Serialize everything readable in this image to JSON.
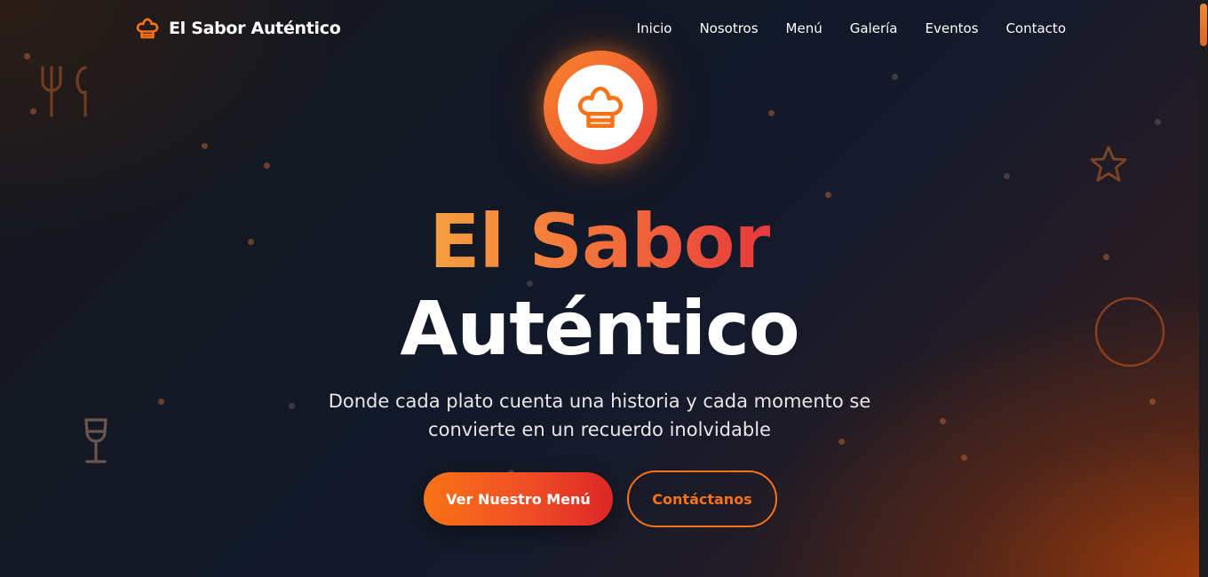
{
  "brand": {
    "name": "El Sabor Auténtico",
    "icon": "chef-hat-icon",
    "accent_color": "#f97316"
  },
  "nav": {
    "items": [
      {
        "label": "Inicio"
      },
      {
        "label": "Nosotros"
      },
      {
        "label": "Menú"
      },
      {
        "label": "Galería"
      },
      {
        "label": "Eventos"
      },
      {
        "label": "Contacto"
      }
    ]
  },
  "hero": {
    "logo_icon": "chef-hat-icon",
    "title_line1": "El Sabor",
    "title_line2": "Auténtico",
    "subtitle": "Donde cada plato cuenta una historia y cada momento se convierte en un recuerdo inolvidable",
    "primary_button": "Ver Nuestro Menú",
    "secondary_button": "Contáctanos",
    "gradient_colors": [
      "#f97316",
      "#dc2626"
    ]
  },
  "decorations": {
    "icons": [
      "fork-knife-icon",
      "star-icon",
      "circle-ring",
      "wine-glass-icon"
    ]
  }
}
